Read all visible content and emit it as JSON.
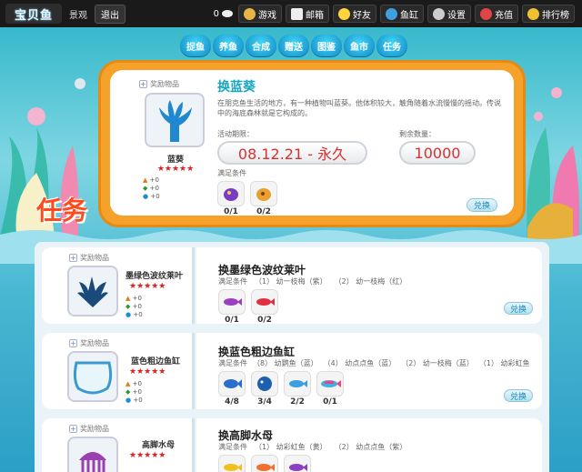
{
  "topbar": {
    "logo": "宝贝鱼",
    "username": "景观",
    "logout": "退出",
    "coins": "0",
    "nav": [
      {
        "label": "游戏",
        "icon": "game-icon",
        "color": "#e8b545"
      },
      {
        "label": "邮箱",
        "icon": "mail-icon",
        "color": "#eeeeee"
      },
      {
        "label": "好友",
        "icon": "friends-icon",
        "color": "#ffd43a"
      },
      {
        "label": "鱼缸",
        "icon": "fishtank-icon",
        "color": "#3fa0e0"
      },
      {
        "label": "设置",
        "icon": "gear-icon",
        "color": "#cccccc"
      },
      {
        "label": "充值",
        "icon": "recharge-icon",
        "color": "#e04444"
      },
      {
        "label": "排行榜",
        "icon": "ranking-icon",
        "color": "#f0c030"
      }
    ]
  },
  "tabs": [
    "捉鱼",
    "养鱼",
    "合成",
    "赠送",
    "图鉴",
    "鱼市",
    "任务"
  ],
  "section_title": "任务",
  "featured": {
    "reward_label": "奖励物品",
    "item_name": "蓝葵",
    "stars": "★★★★★",
    "stats": [
      "+0",
      "+0",
      "+0"
    ],
    "title": "换蓝葵",
    "description": "在朋克鱼生活的地方，有一种植物叫蓝葵。他体积较大，触角随着水流慢慢的摇动。传说中的海底森林就是它构成的。",
    "period_label": "活动期限：",
    "period_value": "08.12.21 - 永久",
    "remaining_label": "剩余数量：",
    "remaining_value": "10000",
    "condition_label": "满足条件",
    "requirements": [
      {
        "icon": "purple-shell-icon",
        "count": "0/1"
      },
      {
        "icon": "orange-shell-icon",
        "count": "0/2"
      }
    ],
    "exchange": "兑换"
  },
  "missions": [
    {
      "reward_label": "奖励物品",
      "item_name": "墨绿色波纹莱叶",
      "stars": "★★★★★",
      "stats": [
        "+0",
        "+0",
        "+0"
      ],
      "title": "换墨绿色波纹莱叶",
      "condition_label": "满足条件",
      "conditions": [
        "（1） 幼一枝梅（紫）",
        "（2） 幼一枝梅（红）"
      ],
      "requirements": [
        {
          "icon": "purple-fish-icon",
          "count": "0/1"
        },
        {
          "icon": "red-fish-icon",
          "count": "0/2"
        }
      ],
      "exchange": "兑换"
    },
    {
      "reward_label": "奖励物品",
      "item_name": "蓝色粗边鱼缸",
      "stars": "★★★★★",
      "stats": [
        "+0",
        "+0",
        "+0"
      ],
      "title": "换蓝色粗边鱼缸",
      "condition_label": "满足条件",
      "conditions": [
        "（8） 幼鹦鱼（蓝）",
        "（4） 幼点点鱼（蓝）",
        "（2） 幼一枝梅（蓝）",
        "（1） 幼彩虹鱼"
      ],
      "requirements": [
        {
          "icon": "blue-fish-icon",
          "count": "4/8"
        },
        {
          "icon": "blue-puffer-icon",
          "count": "3/4"
        },
        {
          "icon": "blue-small-fish-icon",
          "count": "2/2"
        },
        {
          "icon": "rainbow-fish-icon",
          "count": "0/1"
        }
      ],
      "exchange": "兑换"
    },
    {
      "reward_label": "奖励物品",
      "item_name": "高脚水母",
      "stars": "★★★★★",
      "stats": [],
      "title": "换高脚水母",
      "condition_label": "满足条件",
      "conditions": [
        "（1） 幼彩虹鱼（黄）",
        "（2） 幼点点鱼（紫）"
      ],
      "requirements": [
        {
          "icon": "yellow-fish-icon",
          "count": ""
        },
        {
          "icon": "orange-fish-icon",
          "count": ""
        },
        {
          "icon": "purple-fish-icon",
          "count": ""
        }
      ],
      "exchange": ""
    }
  ],
  "colors": {
    "accent_orange": "#f6a22a",
    "title_red": "#ff4a1c",
    "teal": "#17a6c2",
    "star_red": "#e02020"
  }
}
